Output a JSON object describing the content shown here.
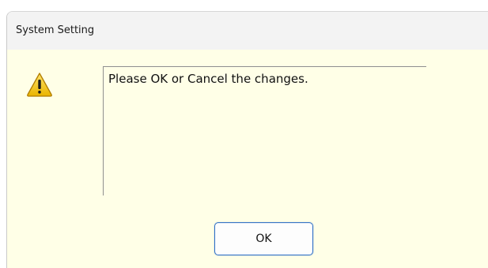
{
  "window": {
    "title": "System Setting"
  },
  "dialog": {
    "icon": "warning-icon",
    "message": "Please OK or Cancel the changes.",
    "ok_label": "OK"
  },
  "colors": {
    "client_background": "#ffffe7",
    "titlebar_background": "#f3f3f3",
    "button_border": "#2f6fc6",
    "warning_fill": "#f2c200"
  }
}
